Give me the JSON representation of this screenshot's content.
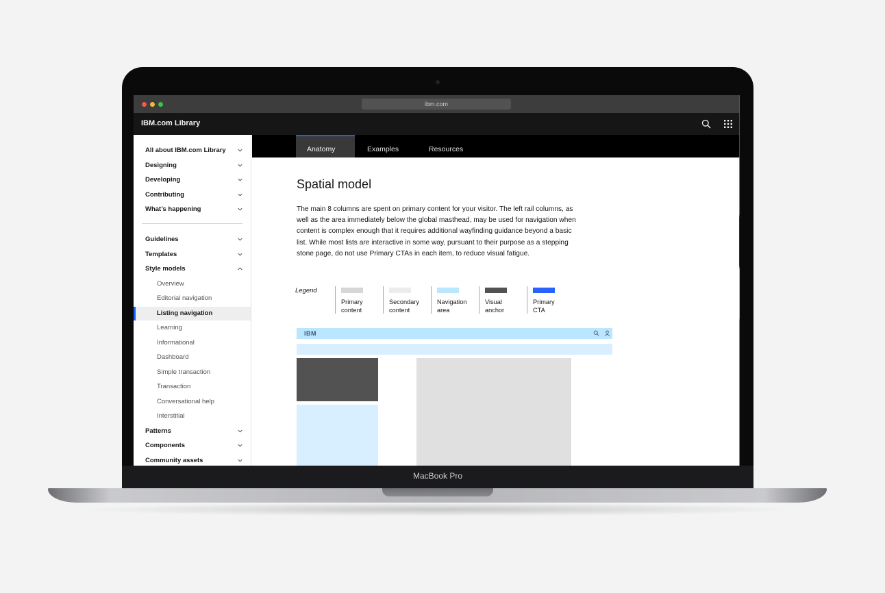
{
  "browser": {
    "url": "ibm.com"
  },
  "masthead": {
    "brand": "IBM.com Library"
  },
  "device": {
    "label": "MacBook Pro"
  },
  "sidebar": {
    "items": [
      {
        "label": "All about IBM.com Library",
        "level": "top",
        "expanded": false
      },
      {
        "label": "Designing",
        "level": "top",
        "expanded": false
      },
      {
        "label": "Developing",
        "level": "top",
        "expanded": false
      },
      {
        "label": "Contributing",
        "level": "top",
        "expanded": false
      },
      {
        "label": "What’s happening",
        "level": "top",
        "expanded": false
      },
      {
        "label": "Guidelines",
        "level": "top",
        "expanded": false
      },
      {
        "label": "Templates",
        "level": "top",
        "expanded": false
      },
      {
        "label": "Style models",
        "level": "top",
        "expanded": true
      },
      {
        "label": "Overview",
        "level": "sub"
      },
      {
        "label": "Editorial navigation",
        "level": "sub"
      },
      {
        "label": "Listing navigation",
        "level": "sub",
        "active": true
      },
      {
        "label": "Learning",
        "level": "sub"
      },
      {
        "label": "Informational",
        "level": "sub"
      },
      {
        "label": "Dashboard",
        "level": "sub"
      },
      {
        "label": "Simple transaction",
        "level": "sub"
      },
      {
        "label": "Transaction",
        "level": "sub"
      },
      {
        "label": "Conversational help",
        "level": "sub"
      },
      {
        "label": "Interstitial",
        "level": "sub"
      },
      {
        "label": "Patterns",
        "level": "top",
        "expanded": false
      },
      {
        "label": "Components",
        "level": "top",
        "expanded": false
      },
      {
        "label": "Community assets",
        "level": "top",
        "expanded": false
      }
    ]
  },
  "tabs": [
    {
      "label": "Anatomy",
      "active": true
    },
    {
      "label": "Examples",
      "active": false
    },
    {
      "label": "Resources",
      "active": false
    }
  ],
  "content": {
    "title": "Spatial model",
    "intro": "The main 8 columns are spent on primary content for your visitor. The left rail columns, as well as the area immediately below the global masthead, may be used for navigation when content is complex enough that it requires additional wayfinding guidance beyond a basic list. While most lists are interactive in some way, pursuant to their purpose as a stepping stone page, do not use Primary CTAs in each item, to reduce visual fatigue."
  },
  "legend": {
    "title": "Legend",
    "items": [
      {
        "label_line1": "Primary",
        "label_line2": "content",
        "color": "#d6d6d6"
      },
      {
        "label_line1": "Secondary",
        "label_line2": "content",
        "color": "#ececec"
      },
      {
        "label_line1": "Navigation",
        "label_line2": "area",
        "color": "#bae6ff"
      },
      {
        "label_line1": "Visual",
        "label_line2": "anchor",
        "color": "#525252"
      },
      {
        "label_line1": "Primary",
        "label_line2": "CTA",
        "color": "#2962ff"
      }
    ]
  },
  "wireframe": {
    "logo": "IBM"
  },
  "colors": {
    "accent": "#0f62fe",
    "masthead": "#161616",
    "tabbar": "#000000"
  }
}
